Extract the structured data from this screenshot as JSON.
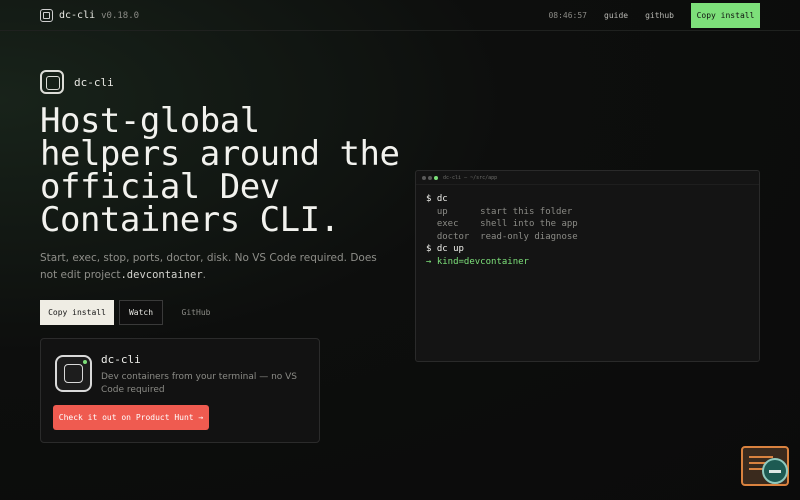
{
  "header": {
    "app_name": "dc-cli",
    "version": "v0.18.0",
    "time": "08:46:57",
    "nav_guide": "guide",
    "nav_github": "github",
    "install_label": "Copy install"
  },
  "hero": {
    "logo_text": "dc-cli",
    "headline": "Host-global helpers around the official Dev Containers CLI.",
    "subtitle_prefix": "Start, exec, stop, ports, doctor, disk. No VS Code required. Does not edit project",
    "subtitle_code": ".devcontainer",
    "subtitle_suffix": ".",
    "btn_install": "Copy install",
    "btn_watch": "Watch",
    "btn_github": "GitHub"
  },
  "product_hunt": {
    "title": "dc-cli",
    "description": "Dev containers from your terminal — no VS Code required",
    "button": "Check it out on Product Hunt →"
  },
  "terminal": {
    "title": "dc-cli — ~/src/app",
    "lines": [
      {
        "text": "$ dc",
        "style": "prompt"
      },
      {
        "text": "  up      start this folder",
        "style": "muted"
      },
      {
        "text": "  exec    shell into the app",
        "style": "muted"
      },
      {
        "text": "  doctor  read-only diagnose",
        "style": "muted"
      },
      {
        "text": "$ dc up",
        "style": "prompt"
      },
      {
        "text": "→ kind=devcontainer",
        "style": "green"
      }
    ]
  },
  "colors": {
    "accent": "#7de07a",
    "product_hunt": "#ef5b50",
    "background": "#0b0b0b"
  }
}
